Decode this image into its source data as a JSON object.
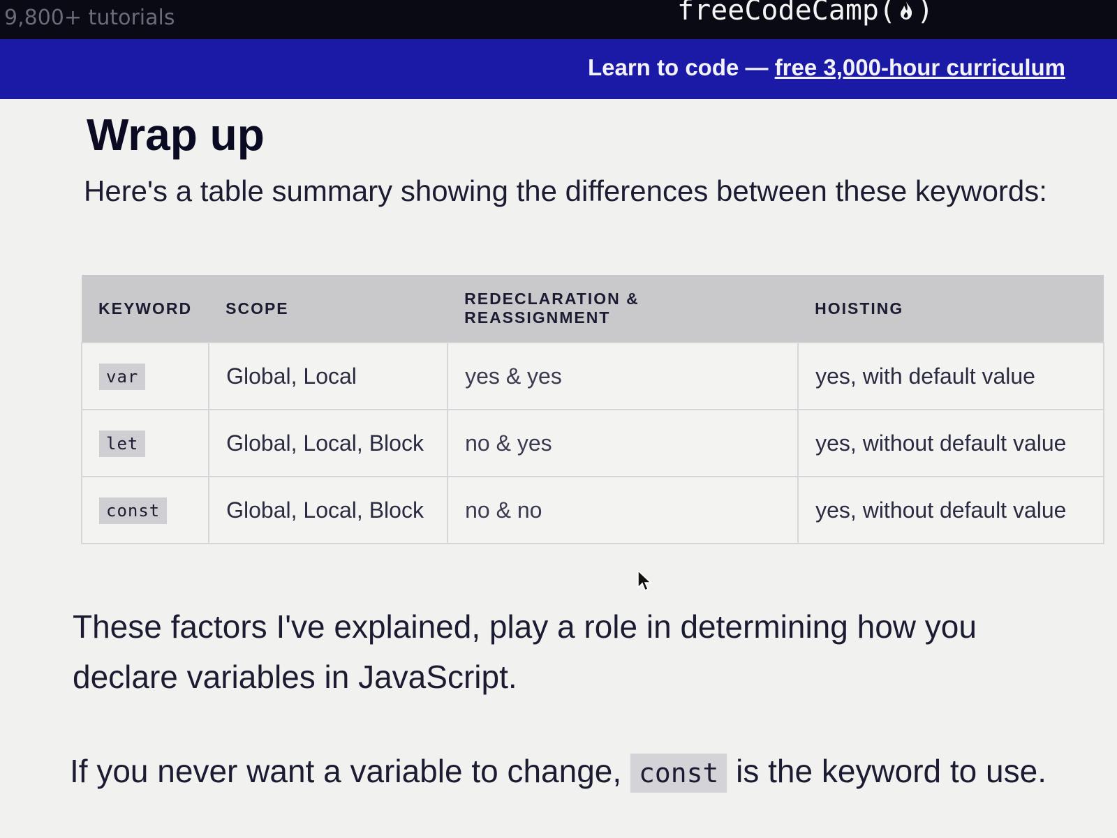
{
  "header": {
    "tutorials": "9,800+ tutorials",
    "brand_text": "freeCodeCamp",
    "brand_paren_open": "(",
    "brand_paren_close": ")",
    "brand_icon": "flame-icon"
  },
  "banner": {
    "text": "Learn to code — ",
    "link": "free 3,000-hour curriculum"
  },
  "article": {
    "heading": "Wrap up",
    "intro": "Here's a table summary showing the differences between these keywords:",
    "table": {
      "headers": [
        "KEYWORD",
        "SCOPE",
        "REDECLARATION & REASSIGNMENT",
        "HOISTING"
      ],
      "rows": [
        {
          "keyword": "var",
          "scope": "Global, Local",
          "redecl": "yes & yes",
          "hoisting": "yes, with default value"
        },
        {
          "keyword": "let",
          "scope": "Global, Local, Block",
          "redecl": "no & yes",
          "hoisting": "yes, without default value"
        },
        {
          "keyword": "const",
          "scope": "Global, Local, Block",
          "redecl": "no & no",
          "hoisting": "yes, without default value"
        }
      ]
    },
    "para1": "These factors I've explained, play a role in determining how you declare variables in JavaScript.",
    "para2_before": "If you never want a variable to change, ",
    "para2_code": "const",
    "para2_after": " is the keyword to use."
  },
  "colors": {
    "topbar": "#0a0a14",
    "banner": "#1a1aa6",
    "background": "#f1f1ef"
  }
}
